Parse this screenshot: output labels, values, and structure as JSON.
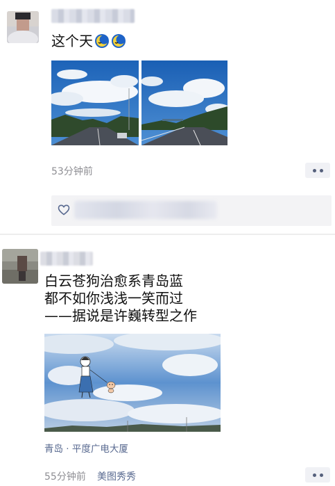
{
  "post1": {
    "text": "这个天",
    "emojis": [
      "sleepy-moon-emoji",
      "sleepy-moon-emoji"
    ],
    "photos": [
      "sky-clouds-road-photo",
      "sky-clouds-highway-photo"
    ],
    "time": "53分钟前",
    "more_icon": "more-dots-icon",
    "like_icon": "heart-outline-icon"
  },
  "post2": {
    "text_lines": [
      "白云苍狗治愈系青岛蓝",
      "都不如你浅浅一笑而过",
      "——据说是许巍转型之作"
    ],
    "photo": "sky-clouds-cartoon-girl-dog-photo",
    "location": "青岛 · 平度广电大厦",
    "time": "55分钟前",
    "source": "美图秀秀",
    "more_icon": "more-dots-icon"
  },
  "colors": {
    "link_blue": "#596a90",
    "time_gray": "#8e8e93",
    "panel_bg": "#f3f3f5",
    "dots": "#55607c"
  }
}
